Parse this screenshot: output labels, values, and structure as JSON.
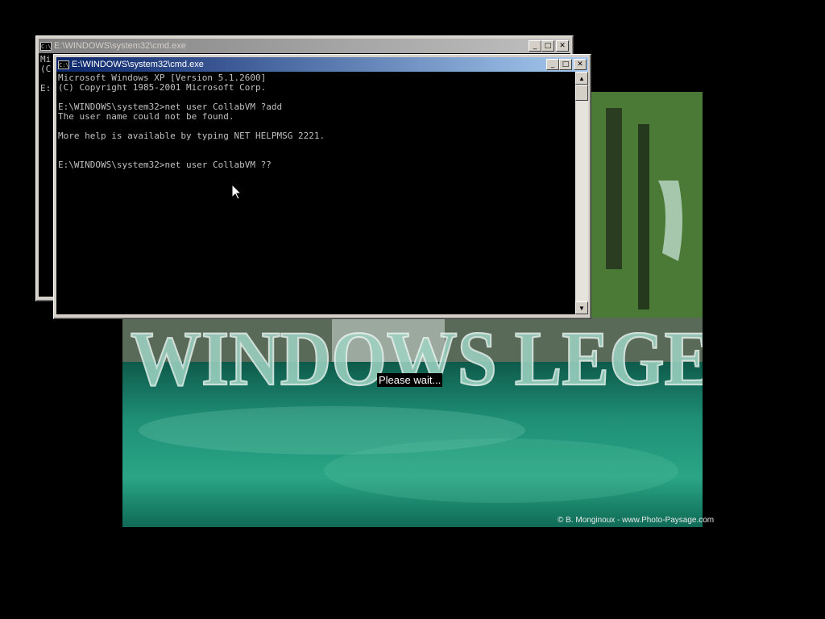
{
  "wallpaper": {
    "banner_text": "WINDOWS LEGENDE",
    "please_wait": "Please wait...",
    "credit": "© B. Monginoux - www.Photo-Paysage.com"
  },
  "back_window": {
    "title": "E:\\WINDOWS\\system32\\cmd.exe",
    "icon": "cmd-icon",
    "lines": [
      "Mi",
      "(C",
      "",
      "E:"
    ]
  },
  "front_window": {
    "title": "E:\\WINDOWS\\system32\\cmd.exe",
    "icon": "cmd-icon",
    "output": "Microsoft Windows XP [Version 5.1.2600]\n(C) Copyright 1985-2001 Microsoft Corp.\n\nE:\\WINDOWS\\system32>net user CollabVM ?add\nThe user name could not be found.\n\nMore help is available by typing NET HELPMSG 2221.\n\n\nE:\\WINDOWS\\system32>net user CollabVM ??"
  },
  "titlebar_buttons": {
    "minimize": "_",
    "maximize": "□",
    "close": "✕"
  },
  "colors": {
    "active_title": "#0a246a",
    "inactive_title": "#808080",
    "console_text": "#c0c0c0",
    "water": "#1a9a7a"
  },
  "cursor": "arrow-cursor-icon"
}
